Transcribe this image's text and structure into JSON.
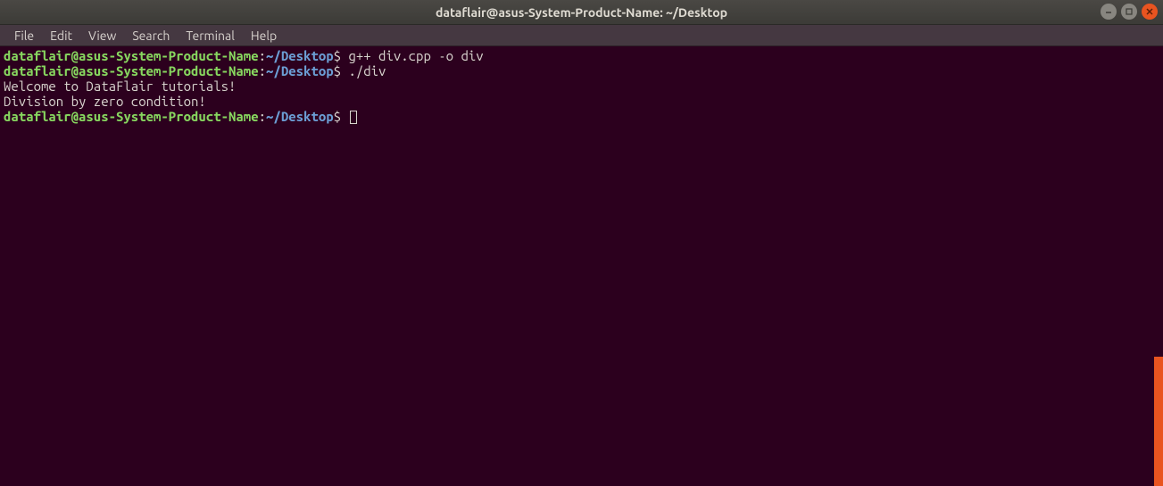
{
  "window": {
    "title": "dataflair@asus-System-Product-Name: ~/Desktop"
  },
  "menu": {
    "file": "File",
    "edit": "Edit",
    "view": "View",
    "search": "Search",
    "terminal": "Terminal",
    "help": "Help"
  },
  "prompt": {
    "user_host": "dataflair@asus-System-Product-Name",
    "colon": ":",
    "tilde": "~",
    "slash": "/",
    "dir": "Desktop",
    "dollar": "$"
  },
  "lines": {
    "cmd1": " g++ div.cpp -o div",
    "cmd2": " ./div",
    "out1": "Welcome to DataFlair tutorials!",
    "blank": "",
    "out2": "Division by zero condition!",
    "cmd3": " "
  }
}
